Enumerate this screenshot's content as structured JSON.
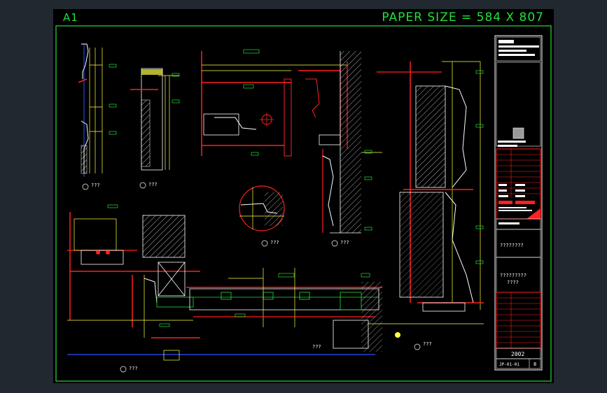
{
  "header": {
    "sheet_id": "A1",
    "paper_size": "PAPER SIZE = 584 X 807"
  },
  "detail_tags": {
    "d1": "???",
    "d2": "???",
    "d3": "???",
    "d4": "???",
    "d5": "???",
    "d6": "???",
    "d7": "???"
  },
  "title_block": {
    "notes_1": "????????",
    "notes_2": "?????????",
    "notes_3": "????",
    "year": "2002",
    "drawing_no": "JP-01-01",
    "sheet_no": "8"
  },
  "colors": {
    "background": "#000000",
    "outer": "#212830",
    "frame": "#22e03a",
    "red": "#ff2020",
    "yellow": "#ffff40",
    "white": "#ffffff",
    "cyan": "#40e0e0",
    "blue": "#3050ff",
    "magenta": "#ff40ff"
  }
}
